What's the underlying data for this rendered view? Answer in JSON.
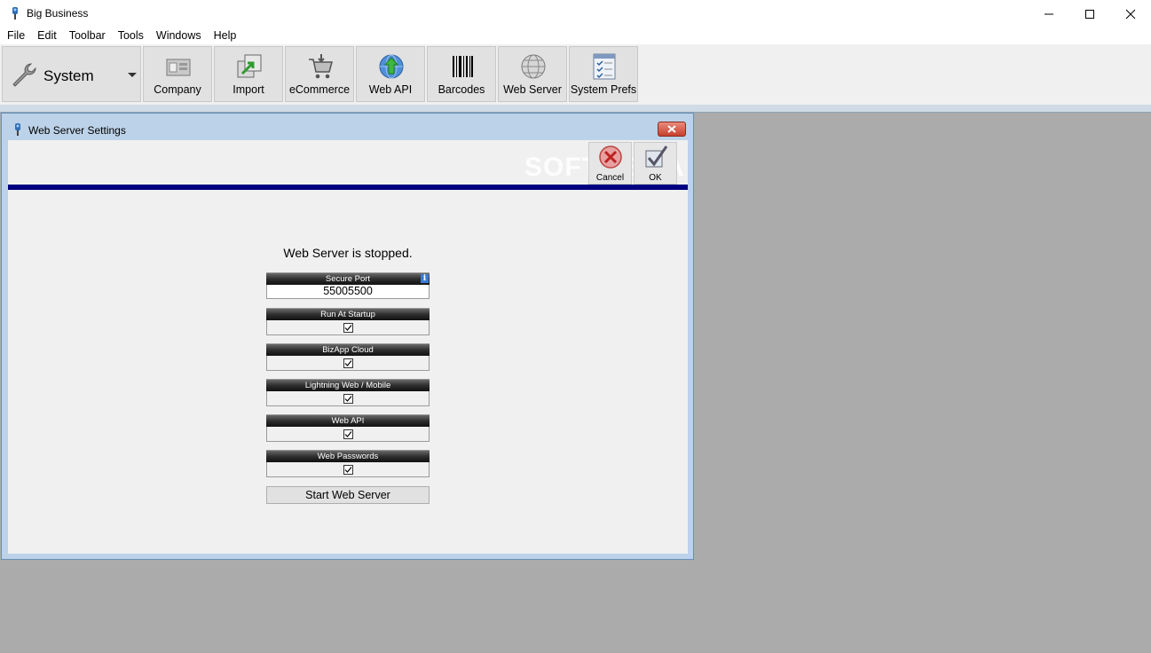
{
  "app": {
    "title": "Big Business"
  },
  "window_controls": {
    "minimize": "—",
    "maximize": "☐",
    "close": "✕"
  },
  "menu": [
    "File",
    "Edit",
    "Toolbar",
    "Tools",
    "Windows",
    "Help"
  ],
  "toolbar": {
    "system_label": "System",
    "system_icon": "wrench-icon",
    "buttons": [
      {
        "label": "Company",
        "icon": "company-icon"
      },
      {
        "label": "Import",
        "icon": "import-icon"
      },
      {
        "label": "eCommerce",
        "icon": "cart-icon"
      },
      {
        "label": "Web API",
        "icon": "globe-arrow-icon"
      },
      {
        "label": "Barcodes",
        "icon": "barcode-icon"
      },
      {
        "label": "Web Server",
        "icon": "globe-icon"
      },
      {
        "label": "System Prefs",
        "icon": "checklist-icon"
      }
    ]
  },
  "dialog": {
    "title": "Web Server Settings",
    "watermark": "SOFTPEDIA",
    "cancel_label": "Cancel",
    "ok_label": "OK",
    "status": "Web Server is stopped.",
    "secure_port": {
      "label": "Secure Port",
      "value": "55005500",
      "info": "i"
    },
    "options": [
      {
        "label": "Run At Startup",
        "checked": true
      },
      {
        "label": "BizApp Cloud",
        "checked": true
      },
      {
        "label": "Lightning Web / Mobile",
        "checked": true
      },
      {
        "label": "Web API",
        "checked": true
      },
      {
        "label": "Web Passwords",
        "checked": true
      }
    ],
    "start_button": "Start Web Server"
  },
  "colors": {
    "accent_navy": "#000080",
    "dialog_frame": "#bcd2e8",
    "workspace": "#ababab"
  }
}
